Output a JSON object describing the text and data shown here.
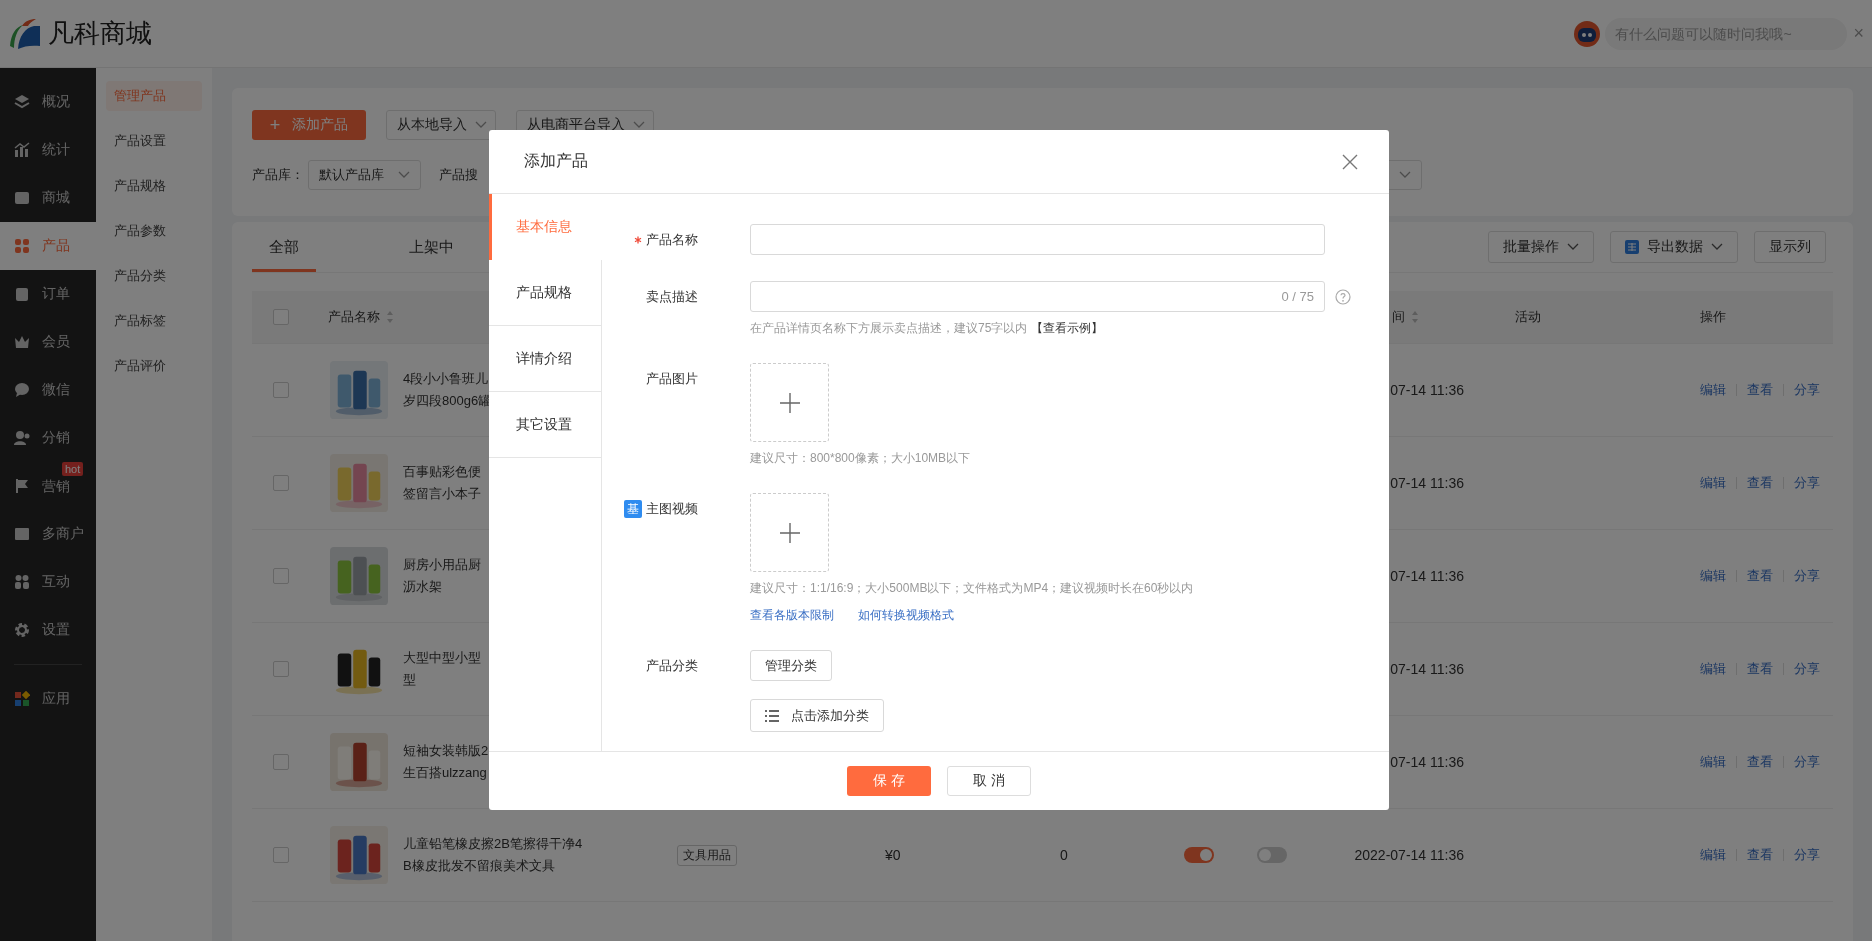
{
  "header": {
    "logo_text": "凡科商城",
    "assistant": {
      "placeholder": "有什么问题可以随时问我哦~",
      "close": "×"
    }
  },
  "nav": [
    {
      "label": "概况",
      "selected": false
    },
    {
      "label": "统计",
      "selected": false
    },
    {
      "label": "商城",
      "selected": false
    },
    {
      "label": "产品",
      "selected": true
    },
    {
      "label": "订单",
      "selected": false
    },
    {
      "label": "会员",
      "selected": false
    },
    {
      "label": "微信",
      "selected": false
    },
    {
      "label": "分销",
      "selected": false
    },
    {
      "label": "营销",
      "selected": false,
      "badge": "hot"
    },
    {
      "label": "多商户",
      "selected": false
    },
    {
      "label": "互动",
      "selected": false
    },
    {
      "label": "设置",
      "selected": false
    },
    {
      "label": "应用",
      "selected": false
    }
  ],
  "subnav": [
    {
      "label": "管理产品",
      "selected": true
    },
    {
      "label": "产品设置",
      "selected": false
    },
    {
      "label": "产品规格",
      "selected": false
    },
    {
      "label": "产品参数",
      "selected": false
    },
    {
      "label": "产品分类",
      "selected": false
    },
    {
      "label": "产品标签",
      "selected": false
    },
    {
      "label": "产品评价",
      "selected": false
    }
  ],
  "toolbar": {
    "add_icon": "+",
    "add_button": "添加产品",
    "import_buttons": [
      "从本地导入",
      "从电商平台导入"
    ],
    "library_label": "产品库：",
    "library_value": "默认产品库",
    "search_label": "产品搜"
  },
  "tabs": [
    {
      "label": "全部",
      "selected": true
    },
    {
      "label": "上架中",
      "selected": false
    }
  ],
  "actions": [
    {
      "label": "批量操作",
      "kind": "dropdown"
    },
    {
      "label": "导出数据",
      "kind": "export"
    },
    {
      "label": "显示列",
      "kind": "plain"
    }
  ],
  "table": {
    "header_checked": false,
    "columns": [
      {
        "label": "产品名称",
        "sortable": true
      },
      {
        "label": "间",
        "sortable": true
      },
      {
        "label": "活动",
        "sortable": false
      },
      {
        "label": "操作",
        "sortable": false
      }
    ],
    "rows": [
      {
        "checked": false,
        "name_lines": [
          "4段小小鲁班儿",
          "岁四段800g6罐"
        ],
        "time": "07-14 11:36",
        "actions": [
          "编辑",
          "查看",
          "分享"
        ]
      },
      {
        "checked": false,
        "name_lines": [
          "百事贴彩色便",
          "签留言小本子"
        ],
        "time": "07-14 11:36",
        "actions": [
          "编辑",
          "查看",
          "分享"
        ]
      },
      {
        "checked": false,
        "name_lines": [
          "厨房小用品厨",
          "沥水架"
        ],
        "time": "07-14 11:36",
        "actions": [
          "编辑",
          "查看",
          "分享"
        ]
      },
      {
        "checked": false,
        "name_lines": [
          "大型中型小型",
          "型"
        ],
        "time": "07-14 11:36",
        "actions": [
          "编辑",
          "查看",
          "分享"
        ]
      },
      {
        "checked": false,
        "name_lines": [
          "短袖女装韩版2",
          "生百搭ulzzang"
        ],
        "time": "07-14 11:36",
        "actions": [
          "编辑",
          "查看",
          "分享"
        ]
      },
      {
        "checked": false,
        "name_lines": [
          "儿童铅笔橡皮擦2B笔擦得干净4",
          "B橡皮批发不留痕美术文具"
        ],
        "category": "文具用品",
        "price": "¥0",
        "stock": "0",
        "toggles": [
          {
            "on": true
          },
          {
            "on": false
          }
        ],
        "time": "2022-07-14 11:36",
        "actions": [
          "编辑",
          "查看",
          "分享"
        ]
      }
    ]
  },
  "dialog": {
    "title": "添加产品",
    "side_tabs": [
      {
        "label": "基本信息",
        "selected": true
      },
      {
        "label": "产品规格",
        "selected": false
      },
      {
        "label": "详情介绍",
        "selected": false
      },
      {
        "label": "其它设置",
        "selected": false
      }
    ],
    "form": [
      {
        "kind": "text",
        "label": "产品名称",
        "required": true
      },
      {
        "kind": "counter",
        "label": "卖点描述",
        "required": false,
        "counter": "0 / 75",
        "hint": "在产品详情页名称下方展示卖点描述，建议75字以内",
        "hint_link": "【查看示例】"
      },
      {
        "kind": "upload",
        "label": "产品图片",
        "required": false,
        "hint": "建议尺寸：800*800像素；大小10MB以下"
      },
      {
        "kind": "upload",
        "label": "主图视频",
        "required": false,
        "badge": "基",
        "hint": "建议尺寸：1:1/16:9；大小500MB以下；文件格式为MP4；建议视频时长在60秒以内",
        "links": [
          "查看各版本限制",
          "如何转换视频格式"
        ]
      },
      {
        "kind": "category",
        "label": "产品分类",
        "required": false,
        "buttons": [
          "管理分类",
          "点击添加分类"
        ]
      }
    ],
    "footer": [
      {
        "label": "保存",
        "kind": "primary"
      },
      {
        "label": "取消",
        "kind": "default"
      }
    ]
  }
}
